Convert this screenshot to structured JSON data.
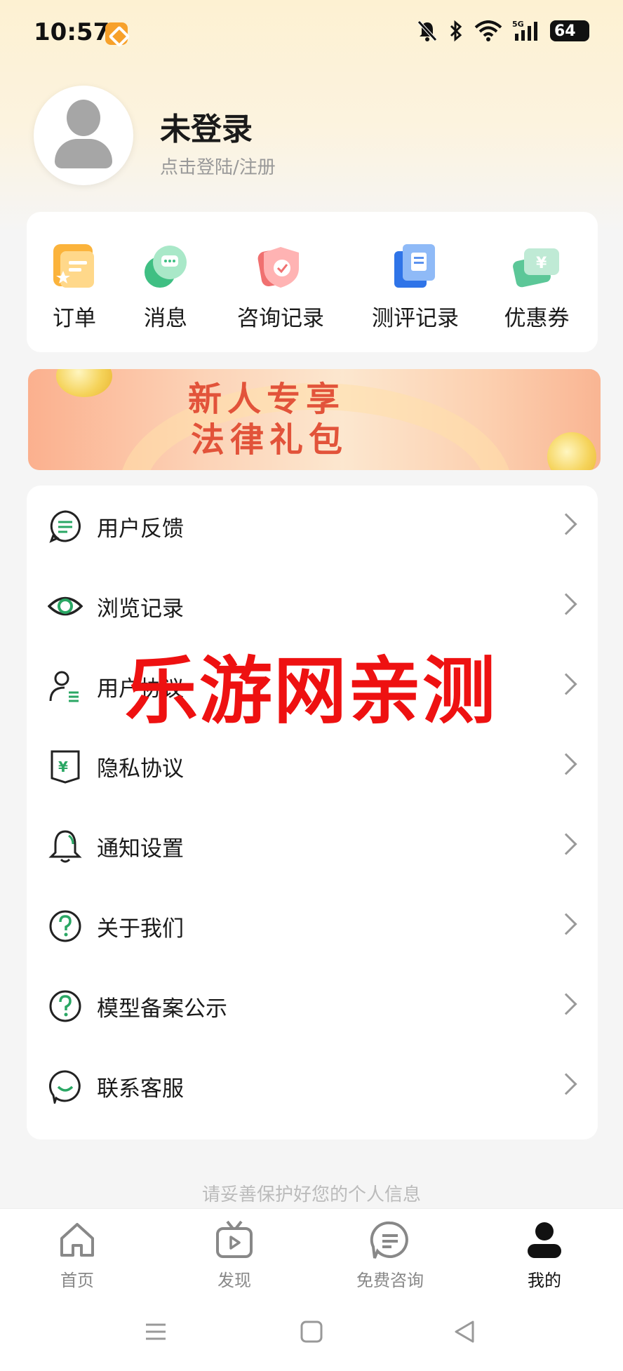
{
  "status": {
    "time": "10:57",
    "battery": "64",
    "network": "5G"
  },
  "profile": {
    "name": "未登录",
    "hint": "点击登陆/注册"
  },
  "quick_menu": [
    {
      "label": "订单",
      "icon": "order-icon"
    },
    {
      "label": "消息",
      "icon": "message-icon"
    },
    {
      "label": "咨询记录",
      "icon": "consult-record-icon"
    },
    {
      "label": "测评记录",
      "icon": "assessment-record-icon"
    },
    {
      "label": "优惠券",
      "icon": "coupon-icon"
    }
  ],
  "banner": {
    "line1": "新人专享",
    "line2": "法律礼包"
  },
  "settings": [
    {
      "label": "用户反馈",
      "icon": "feedback-icon"
    },
    {
      "label": "浏览记录",
      "icon": "eye-icon"
    },
    {
      "label": "用户协议",
      "icon": "user-agreement-icon"
    },
    {
      "label": "隐私协议",
      "icon": "privacy-icon"
    },
    {
      "label": "通知设置",
      "icon": "bell-icon"
    },
    {
      "label": "关于我们",
      "icon": "question-icon"
    },
    {
      "label": "模型备案公示",
      "icon": "question-icon"
    },
    {
      "label": "联系客服",
      "icon": "customer-service-icon"
    }
  ],
  "watermark": "乐游网亲测",
  "privacy_note": "请妥善保护好您的个人信息",
  "bottom_nav": [
    {
      "label": "首页",
      "icon": "home-icon"
    },
    {
      "label": "发现",
      "icon": "discover-tv-icon"
    },
    {
      "label": "免费咨询",
      "icon": "chat-icon"
    },
    {
      "label": "我的",
      "icon": "profile-icon"
    }
  ],
  "colors": {
    "accent_green": "#2aa764",
    "watermark_red": "#ee1111",
    "top_gradient": "#fdf1d2"
  }
}
